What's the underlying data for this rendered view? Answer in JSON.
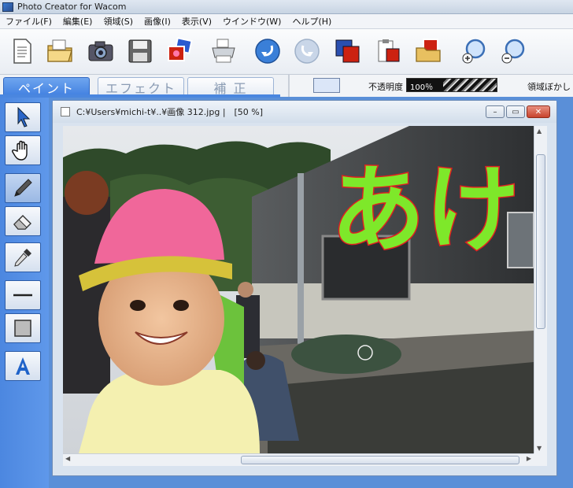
{
  "app": {
    "title": "Photo Creator for Wacom"
  },
  "menu": [
    "ファイル(F)",
    "編集(E)",
    "領域(S)",
    "画像(I)",
    "表示(V)",
    "ウインドウ(W)",
    "ヘルプ(H)"
  ],
  "toolbar": {
    "icons": [
      "new-document-icon",
      "open-folder-icon",
      "camera-icon",
      "save-disk-icon",
      "photo-stack-icon",
      "print-icon",
      "undo-icon",
      "redo-icon",
      "copy-image-icon",
      "paste-clipboard-icon",
      "open-image-folder-icon",
      "zoom-in-icon",
      "zoom-out-icon"
    ]
  },
  "tabs": [
    {
      "label": "ペイント",
      "active": true
    },
    {
      "label": "エフェクト",
      "active": false
    },
    {
      "label": "補 正",
      "active": false
    }
  ],
  "options": {
    "color_swatch": "#dbe6f8",
    "opacity_label": "不透明度",
    "opacity_value": "100％",
    "opacity_percent": 40,
    "blur_label": "領域ぼかし"
  },
  "tools": [
    {
      "icon": "arrow-select-icon",
      "active": false
    },
    {
      "icon": "hand-pan-icon",
      "active": false
    },
    {
      "icon": "brush-pen-icon",
      "active": true
    },
    {
      "icon": "eraser-icon",
      "active": false
    },
    {
      "icon": "eyedropper-icon",
      "active": false
    },
    {
      "icon": "line-tool-icon",
      "active": false
    },
    {
      "icon": "rectangle-tool-icon",
      "active": false
    },
    {
      "icon": "text-tool-icon",
      "active": false
    }
  ],
  "document": {
    "title": "C:¥Users¥michi-t¥..¥画像 312.jpg |　[50 %]",
    "painted_text": "あけ",
    "stroke_color": "#7ee82a",
    "outline_color": "#e02020"
  },
  "window_buttons": {
    "minimize": "–",
    "maximize": "▭",
    "close": "✕"
  }
}
